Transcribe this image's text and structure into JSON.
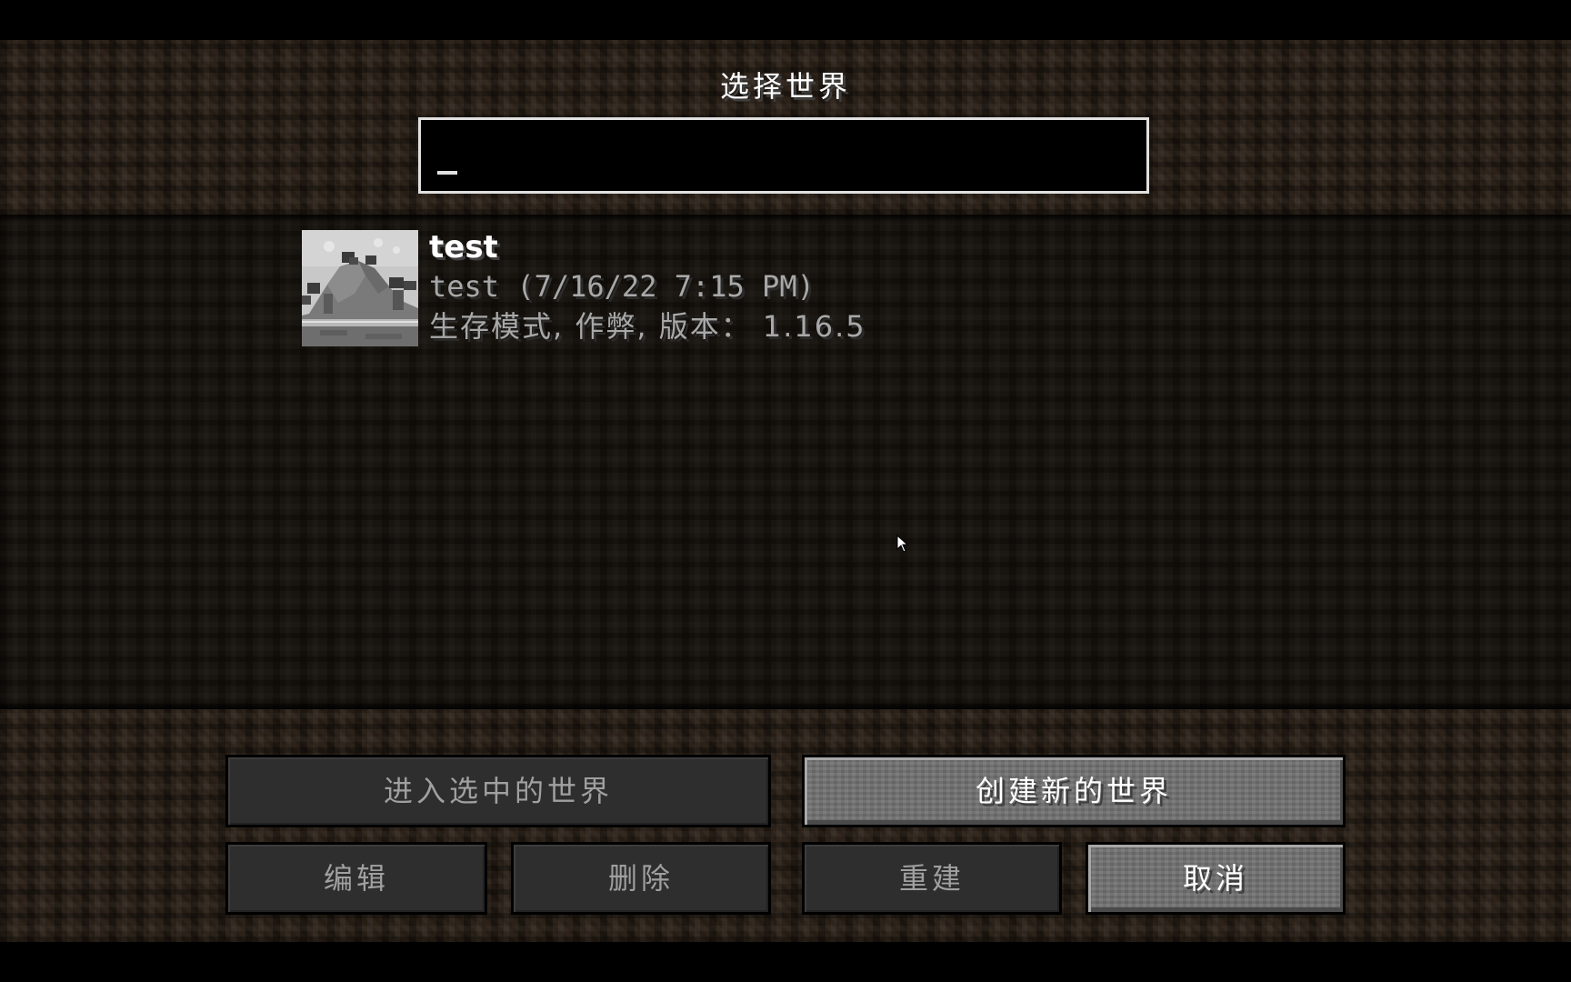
{
  "screen": {
    "title": "选择世界"
  },
  "search": {
    "value": "",
    "placeholder": ""
  },
  "worlds": [
    {
      "name": "test",
      "info": "test (7/16/22 7:15 PM)",
      "details": "生存模式, 作弊, 版本： 1.16.5"
    }
  ],
  "buttons": {
    "play_selected": "进入选中的世界",
    "create_new": "创建新的世界",
    "edit": "编辑",
    "delete": "删除",
    "recreate": "重建",
    "cancel": "取消"
  },
  "icons": {
    "world_thumbnail": "world-thumbnail-icon",
    "mouse_cursor": "mouse-cursor-icon"
  },
  "colors": {
    "title_text": "#ffffff",
    "info_text": "#a8a8a8",
    "button_disabled": "#2e2e2e",
    "button_active": "#707070"
  }
}
